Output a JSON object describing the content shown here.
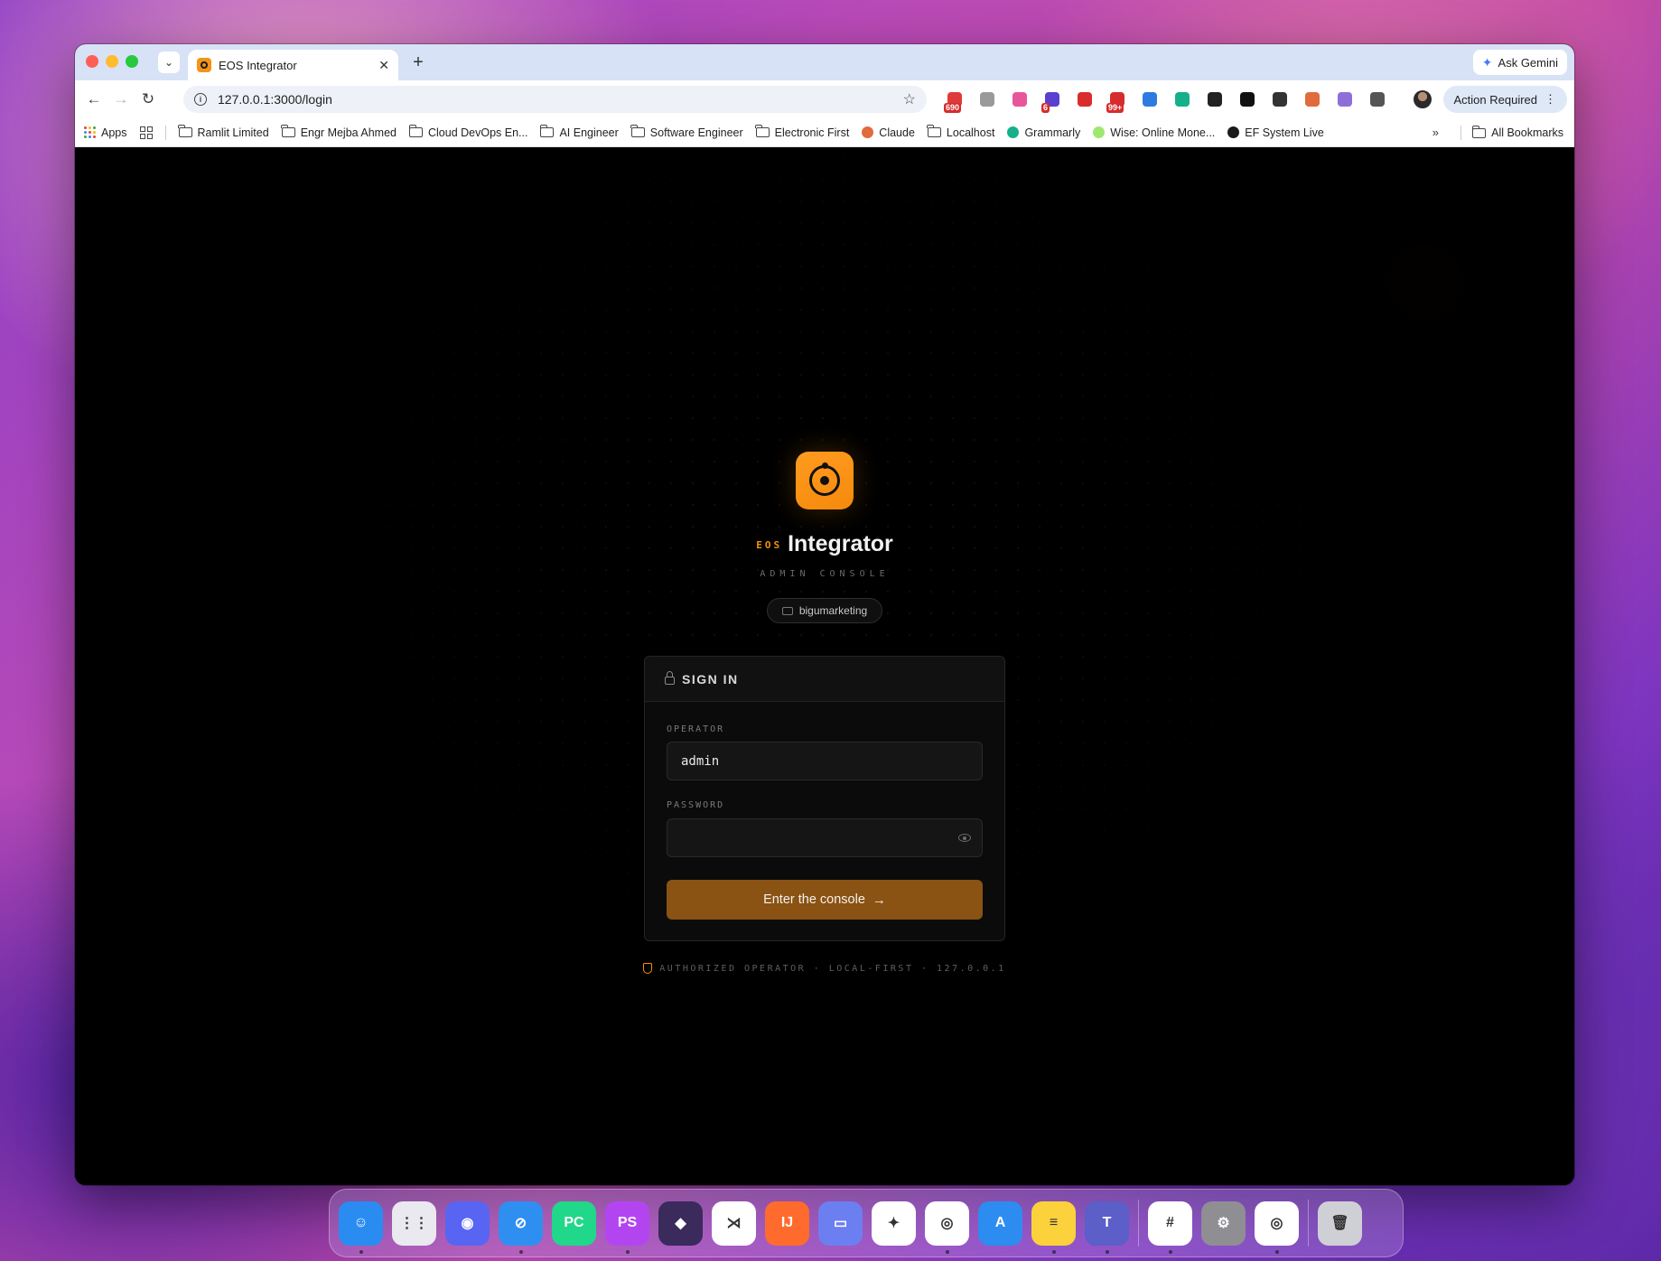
{
  "browser": {
    "tab": {
      "title": "EOS Integrator"
    },
    "new_tab": "+",
    "ask_gemini": "Ask Gemini",
    "url": "127.0.0.1:3000/login",
    "action_required": "Action Required",
    "extensions": [
      {
        "name": "calendar-extension-icon",
        "badge": "690",
        "color": "#e03a3a"
      },
      {
        "name": "camera-extension-icon",
        "badge": "",
        "color": "#9a9a9a"
      },
      {
        "name": "pink-arrow-extension-icon",
        "badge": "",
        "color": "#e8559b"
      },
      {
        "name": "purple-extension-icon",
        "badge": "6",
        "color": "#5b3fd1"
      },
      {
        "name": "red-extension-icon",
        "badge": "",
        "color": "#d92c2c"
      },
      {
        "name": "mail-extension-icon",
        "badge": "99+",
        "color": "#d62c2c"
      },
      {
        "name": "tag-extension-icon",
        "badge": "",
        "color": "#2f7ae0"
      },
      {
        "name": "grammarly-extension-icon",
        "badge": "",
        "color": "#15b08a"
      },
      {
        "name": "tools-extension-icon",
        "badge": "",
        "color": "#222222"
      },
      {
        "name": "circle-extension-icon",
        "badge": "",
        "color": "#111111"
      },
      {
        "name": "pen-extension-icon",
        "badge": "",
        "color": "#333333"
      },
      {
        "name": "claude-extension-icon",
        "badge": "",
        "color": "#e06b3c"
      },
      {
        "name": "crystal-extension-icon",
        "badge": "",
        "color": "#8e6fd8"
      },
      {
        "name": "puzzle-extension-icon",
        "badge": "",
        "color": "#555555"
      }
    ],
    "bookmarks": [
      {
        "label": "Ramlit Limited",
        "type": "folder"
      },
      {
        "label": "Engr Mejba Ahmed",
        "type": "folder"
      },
      {
        "label": "Cloud DevOps En...",
        "type": "folder"
      },
      {
        "label": "AI Engineer",
        "type": "folder"
      },
      {
        "label": "Software Engineer",
        "type": "folder"
      },
      {
        "label": "Electronic First",
        "type": "folder"
      },
      {
        "label": "Claude",
        "type": "link"
      },
      {
        "label": "Localhost",
        "type": "folder"
      },
      {
        "label": "Grammarly",
        "type": "link"
      },
      {
        "label": "Wise: Online Mone...",
        "type": "link"
      },
      {
        "label": "EF System Live",
        "type": "link"
      }
    ],
    "apps_label": "Apps",
    "bookmarks_overflow": "»",
    "all_bookmarks": "All Bookmarks"
  },
  "login": {
    "brand_prefix": "EOS",
    "brand_name": "Integrator",
    "subtitle": "ADMIN CONSOLE",
    "tenant": "bigumarketing",
    "card_title": "SIGN IN",
    "operator_label": "OPERATOR",
    "operator_value": "admin",
    "password_label": "PASSWORD",
    "password_value": "",
    "submit_label": "Enter the console",
    "submit_arrow": "→",
    "footer": "AUTHORIZED OPERATOR · LOCAL-FIRST · 127.0.0.1",
    "accent_color": "#f5900f"
  },
  "dock": {
    "apps": [
      {
        "name": "finder",
        "color": "#2a8cf0",
        "glyph": "☺",
        "running": true
      },
      {
        "name": "launchpad",
        "color": "#e9e9ef",
        "glyph": "⋮⋮",
        "running": false
      },
      {
        "name": "discord",
        "color": "#5865f2",
        "glyph": "◉",
        "running": false
      },
      {
        "name": "safari",
        "color": "#2f8ff0",
        "glyph": "⊘",
        "running": true
      },
      {
        "name": "pycharm",
        "color": "#21d789",
        "glyph": "PC",
        "running": false
      },
      {
        "name": "phpstorm",
        "color": "#b345f1",
        "glyph": "PS",
        "running": true
      },
      {
        "name": "obsidian",
        "color": "#3b2a5c",
        "glyph": "◆",
        "running": false
      },
      {
        "name": "vscode",
        "color": "#ffffff",
        "glyph": "⋊",
        "running": false
      },
      {
        "name": "intellij",
        "color": "#ff6b2c",
        "glyph": "IJ",
        "running": false
      },
      {
        "name": "remote-desktop",
        "color": "#6b7ff0",
        "glyph": "▭",
        "running": false
      },
      {
        "name": "gemini",
        "color": "#ffffff",
        "glyph": "✦",
        "running": false
      },
      {
        "name": "chrome",
        "color": "#ffffff",
        "glyph": "◎",
        "running": true
      },
      {
        "name": "app-store",
        "color": "#2d8cf0",
        "glyph": "A",
        "running": false
      },
      {
        "name": "notes",
        "color": "#fbd23c",
        "glyph": "≡",
        "running": true
      },
      {
        "name": "teams",
        "color": "#5b5fc7",
        "glyph": "T",
        "running": true
      },
      {
        "name": "slack",
        "color": "#ffffff",
        "glyph": "#",
        "running": true
      },
      {
        "name": "system-settings",
        "color": "#8e8e93",
        "glyph": "⚙",
        "running": false
      },
      {
        "name": "chrome-2",
        "color": "#ffffff",
        "glyph": "◎",
        "running": true
      },
      {
        "name": "trash",
        "color": "#cfcfd6",
        "glyph": "🗑",
        "running": false
      }
    ]
  }
}
